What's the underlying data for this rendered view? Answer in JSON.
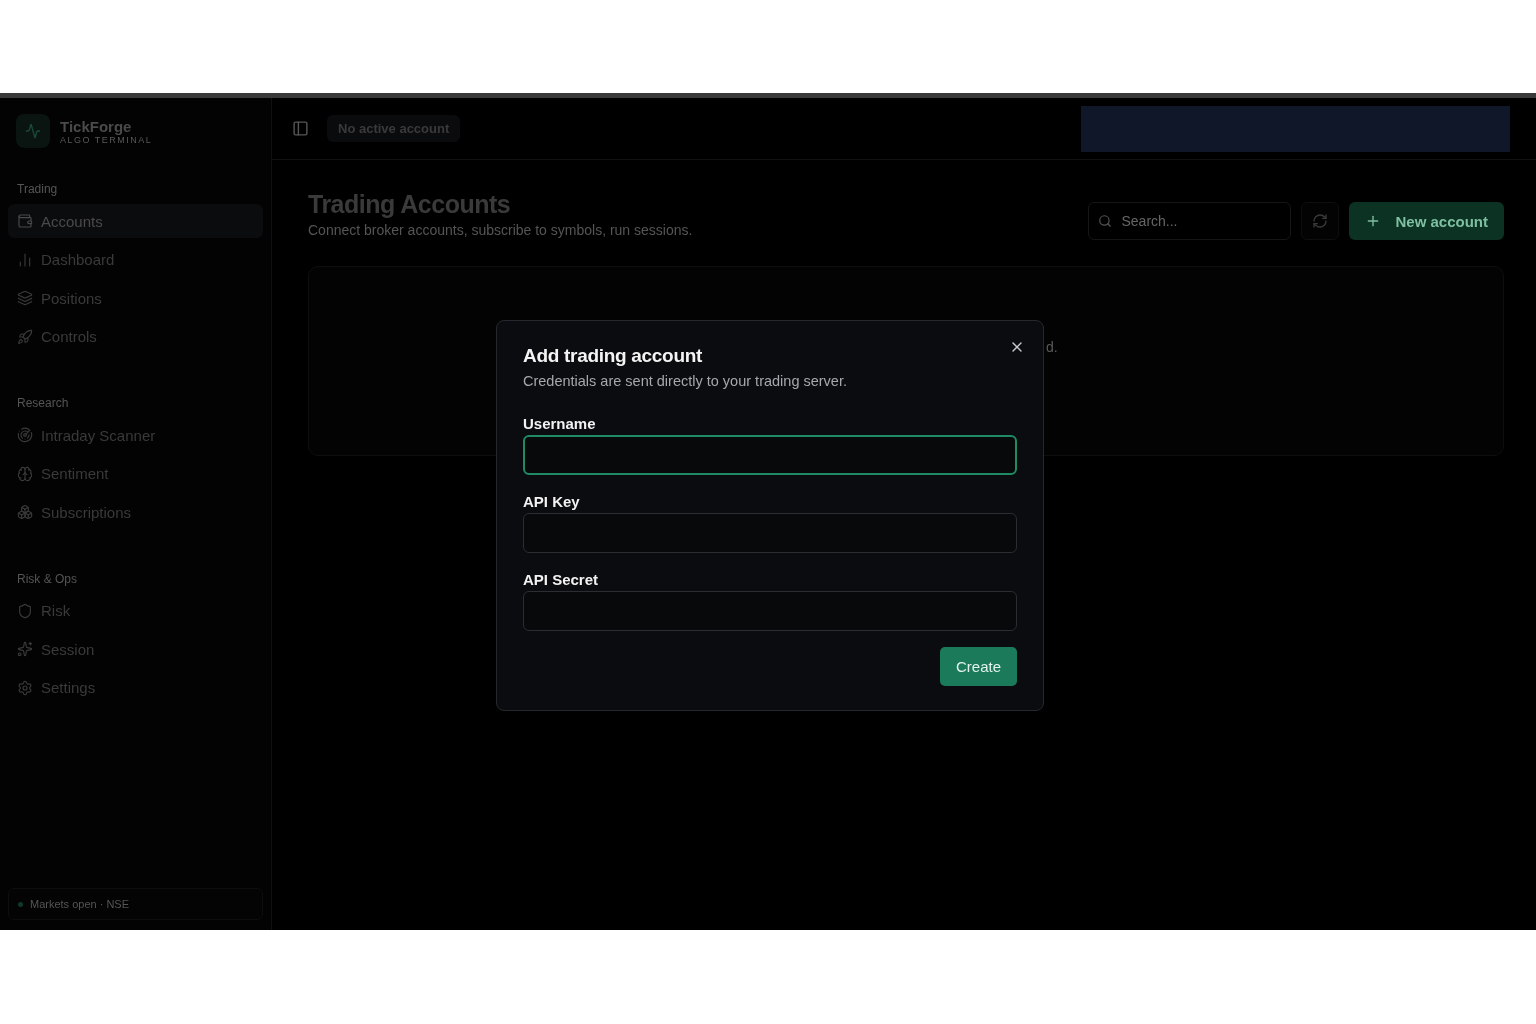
{
  "brand": {
    "name": "TickForge",
    "tagline": "ALGO TERMINAL"
  },
  "sidebar": {
    "sections": [
      {
        "title": "Trading",
        "items": [
          {
            "label": "Accounts",
            "selected": true
          },
          {
            "label": "Dashboard",
            "selected": false
          },
          {
            "label": "Positions",
            "selected": false
          },
          {
            "label": "Controls",
            "selected": false
          }
        ]
      },
      {
        "title": "Research",
        "items": [
          {
            "label": "Intraday Scanner",
            "selected": false
          },
          {
            "label": "Sentiment",
            "selected": false
          },
          {
            "label": "Subscriptions",
            "selected": false
          }
        ]
      },
      {
        "title": "Risk & Ops",
        "items": [
          {
            "label": "Risk",
            "selected": false
          },
          {
            "label": "Session",
            "selected": false
          },
          {
            "label": "Settings",
            "selected": false
          }
        ]
      }
    ],
    "status": "Markets open · NSE"
  },
  "header": {
    "account_badge": "No active account"
  },
  "page": {
    "title": "Trading Accounts",
    "subtitle": "Connect broker accounts, subscribe to symbols, run sessions.",
    "search": {
      "placeholder": "Search..."
    },
    "new_button": "New account",
    "empty_text_fragment": "d."
  },
  "modal": {
    "title": "Add trading account",
    "description": "Credentials are sent directly to your trading server.",
    "fields": [
      {
        "label": "Username",
        "focused": true
      },
      {
        "label": "API Key",
        "focused": false
      },
      {
        "label": "API Secret",
        "focused": false
      }
    ],
    "submit": "Create"
  }
}
